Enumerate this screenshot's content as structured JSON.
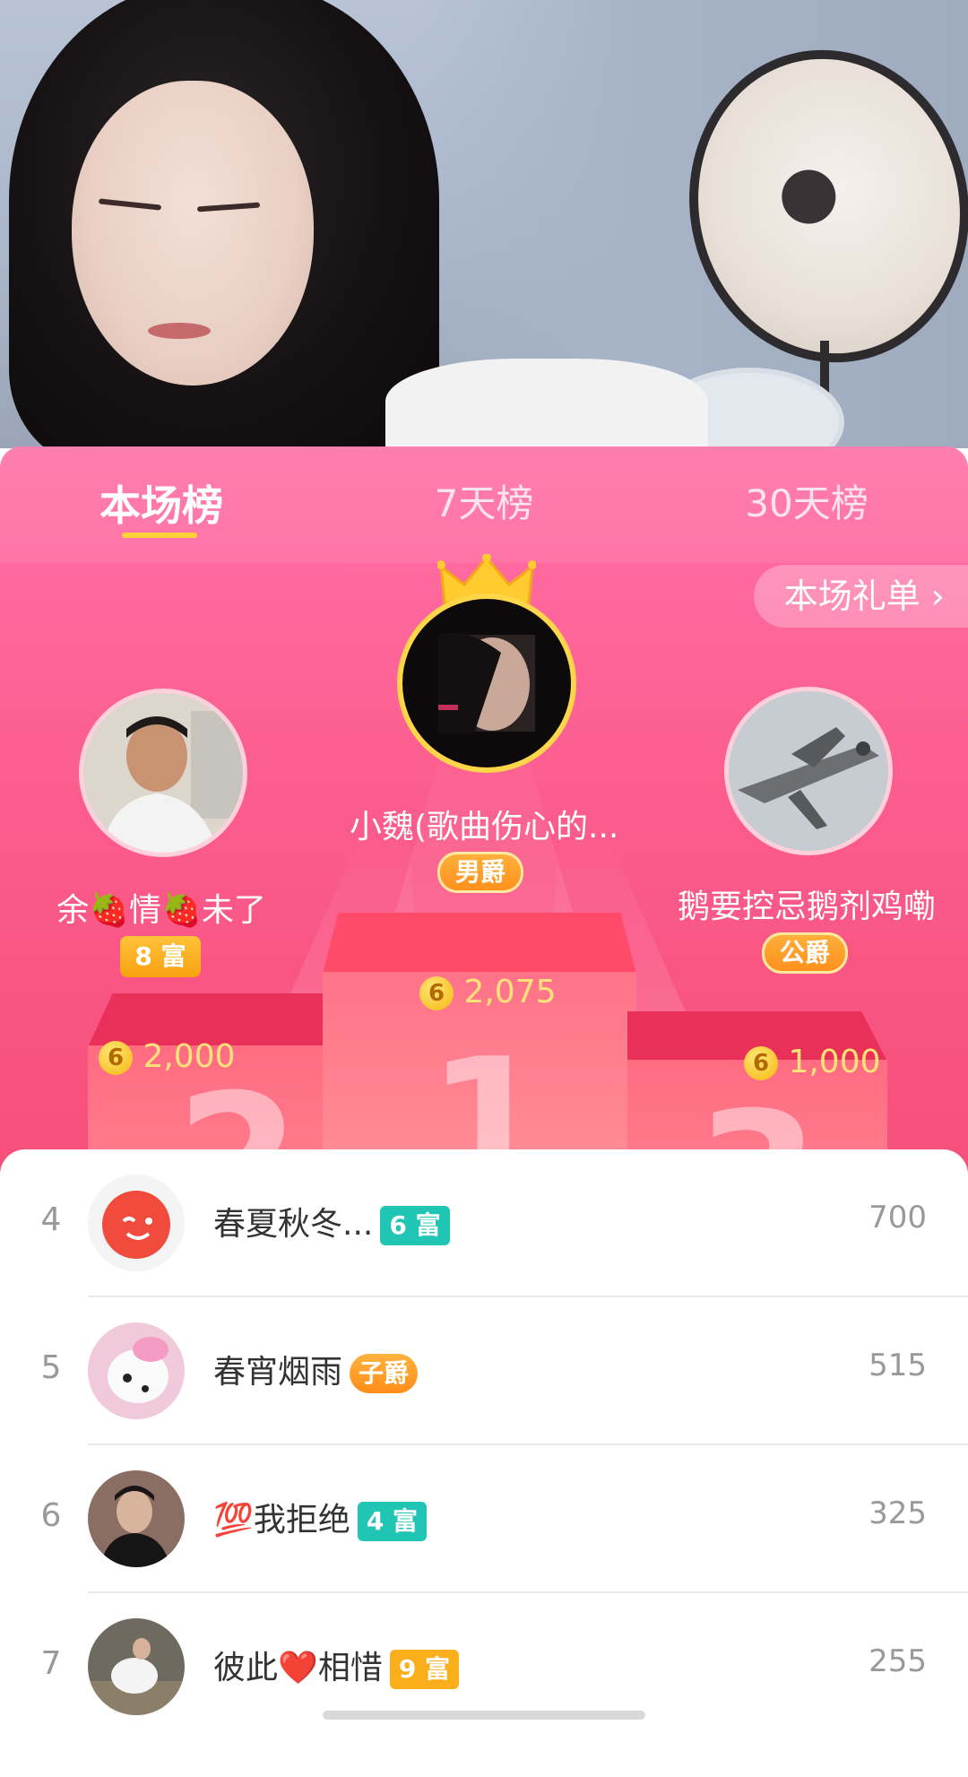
{
  "tabs": [
    {
      "label": "本场榜",
      "active": true
    },
    {
      "label": "7天榜",
      "active": false
    },
    {
      "label": "30天榜",
      "active": false
    }
  ],
  "gift_list_button": "本场礼单 ›",
  "podium": [
    {
      "rank": 1,
      "name": "小魏(歌曲伤心的...",
      "badge": "男爵",
      "score": "2,075",
      "podium_number": "1"
    },
    {
      "rank": 2,
      "name": "余🍓情🍓未了",
      "badge": "8 富",
      "score": "2,000",
      "podium_number": "2"
    },
    {
      "rank": 3,
      "name": "鹅要控忌鹅剂鸡嘞",
      "badge": "公爵",
      "score": "1,000",
      "podium_number": "3"
    }
  ],
  "coin_symbol": "6",
  "list": [
    {
      "rank": "4",
      "name": "春夏秋冬...",
      "badge": "6 富",
      "badge_style": "teal",
      "score": "700"
    },
    {
      "rank": "5",
      "name": "春宵烟雨",
      "badge": "子爵",
      "badge_style": "noble",
      "score": "515"
    },
    {
      "rank": "6",
      "name": "💯我拒绝",
      "badge": "4 富",
      "badge_style": "teal",
      "score": "325"
    },
    {
      "rank": "7",
      "name": "彼此❤️相惜",
      "badge": "9 富",
      "badge_style": "gold",
      "score": "255"
    }
  ],
  "colors": {
    "accent_pink": "#ff6aa0",
    "tab_underline": "#ffd23a",
    "coin_gold": "#ffe37a",
    "badge_teal": "#21c5b4",
    "badge_gold": "#f9ae1a"
  }
}
